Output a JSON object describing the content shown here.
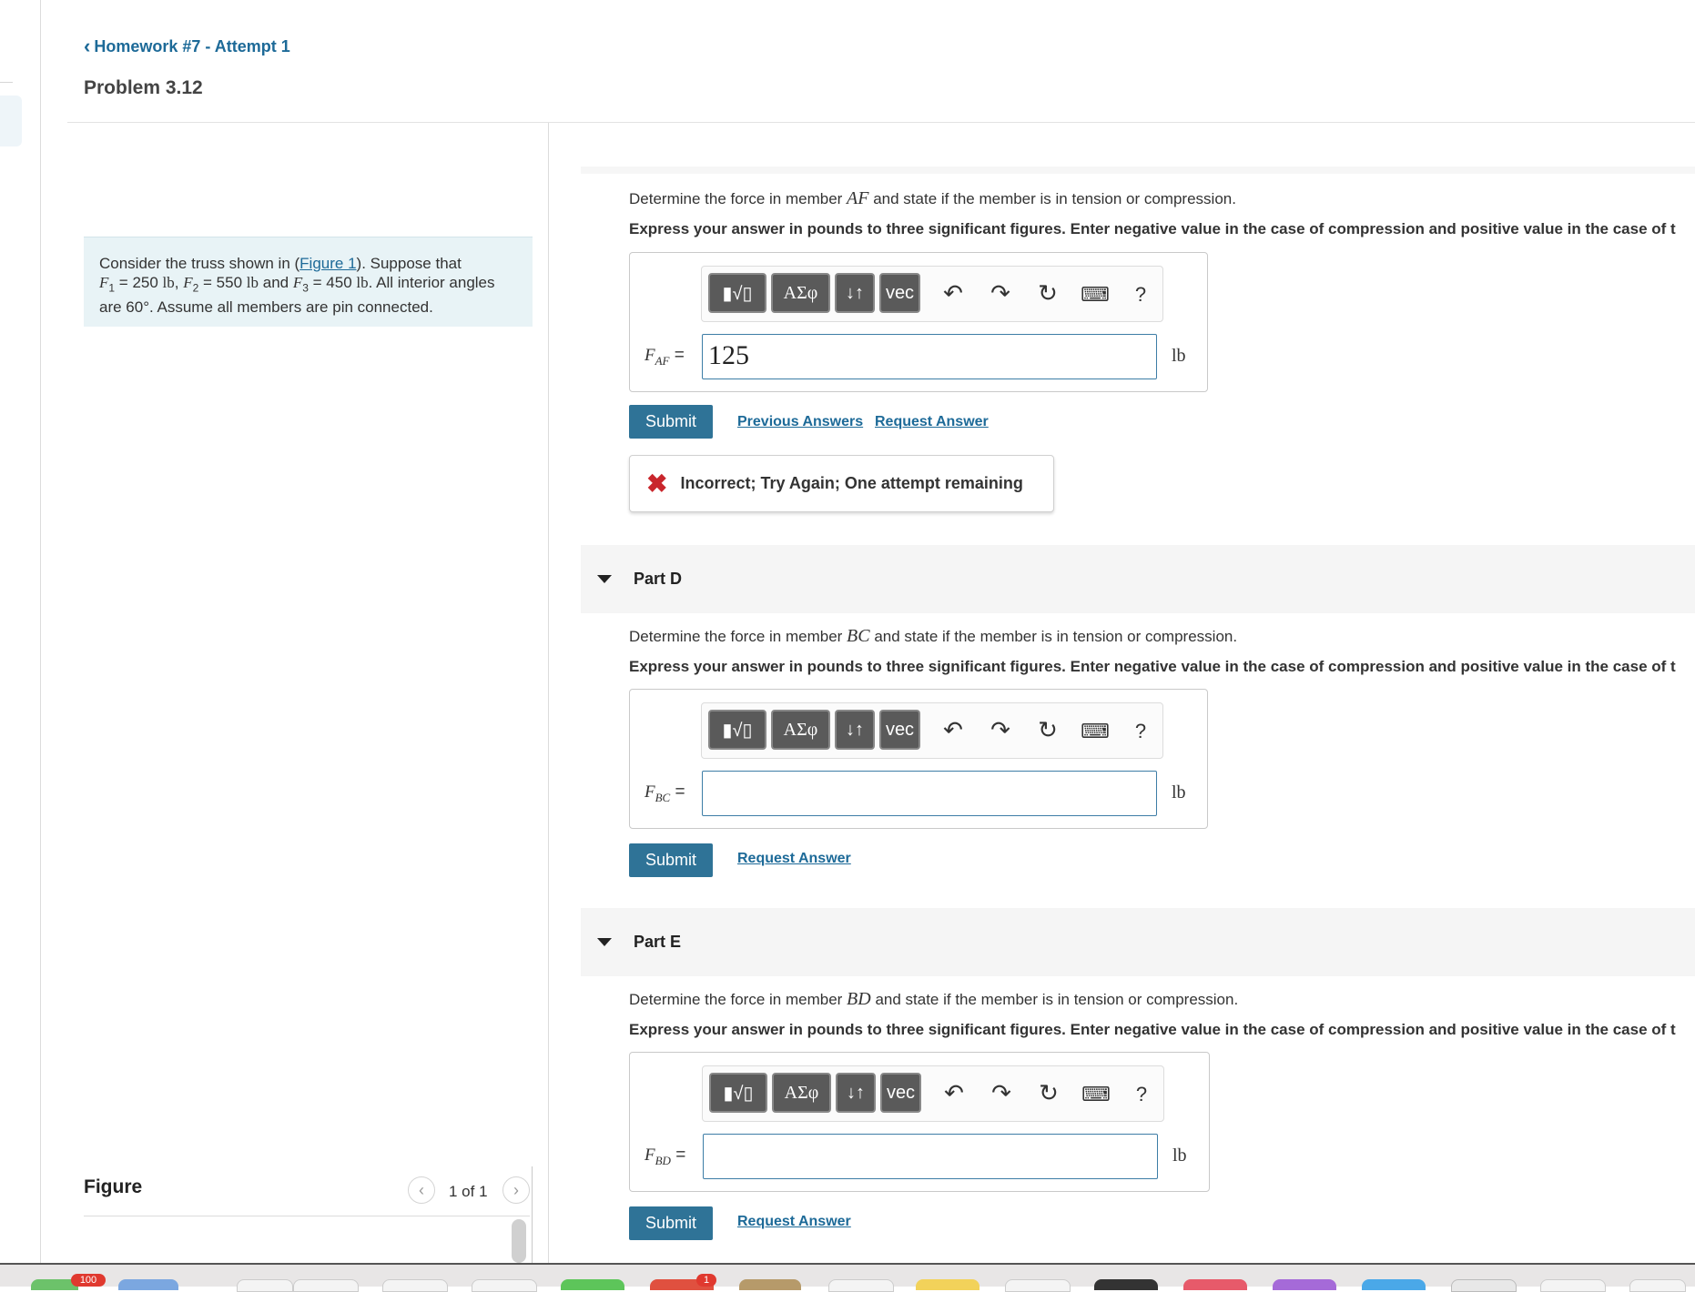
{
  "nav": {
    "back_label": "Homework #7 - Attempt 1",
    "problem_title": "Problem 3.12"
  },
  "problem": {
    "pre_link": "Consider the truss shown in (",
    "link": "Figure 1",
    "post_link": "). Suppose that",
    "f1_sym": "F",
    "f1_sub": "1",
    "f1_val": " = 250 ",
    "f1_unit": "lb",
    "f2_sym": "F",
    "f2_sub": "2",
    "f2_val": " = 550 ",
    "f2_unit": "lb",
    "and": " and ",
    "f3_sym": "F",
    "f3_sub": "3",
    "f3_val": " = 450 ",
    "f3_unit": "lb",
    "rest": ". All interior angles are 60°. Assume all members are pin connected."
  },
  "figure": {
    "label": "Figure",
    "page_count": "1 of 1"
  },
  "toolbar": {
    "templates": "▮√▯",
    "greek": "ΑΣφ",
    "arrows": "↓↑",
    "vec": "vec",
    "undo_icon": "undo-icon",
    "redo_icon": "redo-icon",
    "reset_icon": "reset-icon",
    "keyboard_icon": "keyboard-icon",
    "help": "?"
  },
  "part_c": {
    "q_pre": "Determine the force in member ",
    "member": "AF",
    "q_post": " and state if the member is in tension or compression.",
    "instructions": "Express your answer in pounds to three significant figures. Enter negative value in the case of compression and positive value in the case of t",
    "label_sym": "F",
    "label_sub": "AF",
    "label_eq": " =",
    "value": "125",
    "unit": "lb",
    "submit": "Submit",
    "previous": "Previous Answers",
    "request": "Request Answer",
    "feedback": "Incorrect; Try Again; One attempt remaining",
    "feedback_icon": "✖"
  },
  "part_d": {
    "title": "Part D",
    "q_pre": "Determine the force in member ",
    "member": "BC",
    "q_post": " and state if the member is in tension or compression.",
    "instructions": "Express your answer in pounds to three significant figures. Enter negative value in the case of compression and positive value in the case of t",
    "label_sym": "F",
    "label_sub": "BC",
    "label_eq": " =",
    "value": "",
    "unit": "lb",
    "submit": "Submit",
    "request": "Request Answer"
  },
  "part_e": {
    "title": "Part E",
    "q_pre": "Determine the force in member ",
    "member": "BD",
    "q_post": " and state if the member is in tension or compression.",
    "instructions": "Express your answer in pounds to three significant figures. Enter negative value in the case of compression and positive value in the case of t",
    "label_sym": "F",
    "label_sub": "BD",
    "label_eq": " =",
    "value": "",
    "unit": "lb",
    "submit": "Submit",
    "request": "Request Answer"
  },
  "dock": {
    "badge_1": "100",
    "badge_2": "1"
  },
  "colors": {
    "accent": "#2f7397",
    "link": "#1d6a98",
    "error": "#c9262c",
    "problem_bg": "#e8f3f6"
  }
}
